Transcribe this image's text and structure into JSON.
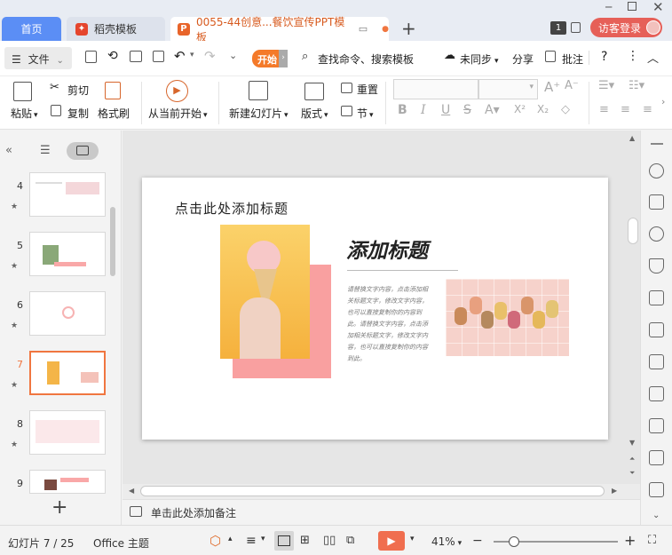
{
  "tabs": {
    "home": "首页",
    "docer": "稻壳模板",
    "doc": "0055-44创意...餐饮宣传PPT模板"
  },
  "account": {
    "badge": "1",
    "login": "访客登录"
  },
  "menu": {
    "file": "文件",
    "start": "开始",
    "search": "查找命令、搜索模板",
    "sync": "未同步",
    "share": "分享",
    "annotate": "批注"
  },
  "ribbon": {
    "paste": "粘贴",
    "cut": "剪切",
    "copy": "复制",
    "format_painter": "格式刷",
    "from_current": "从当前开始",
    "new_slide": "新建幻灯片",
    "layout": "版式",
    "reset": "重置",
    "section": "节"
  },
  "thumbnails": [
    {
      "num": "4",
      "selected": false
    },
    {
      "num": "5",
      "selected": false
    },
    {
      "num": "6",
      "selected": false
    },
    {
      "num": "7",
      "selected": true
    },
    {
      "num": "8",
      "selected": false
    },
    {
      "num": "9",
      "selected": false
    }
  ],
  "slide": {
    "placeholder_title": "点击此处添加标题",
    "heading": "添加标题",
    "body": "请替换文字内容，点击添加相关标题文字，修改文字内容，也可以直接复制你的内容到此。请替换文字内容，点击添加相关标题文字，修改文字内容，也可以直接复制你的内容到此。"
  },
  "notes": {
    "placeholder": "单击此处添加备注"
  },
  "status": {
    "slide_info": "幻灯片 7 / 25",
    "theme": "Office 主题",
    "zoom": "41%"
  },
  "colors": {
    "accent": "#f07640",
    "tab_home": "#5b8ef5",
    "login": "#e66058",
    "pink": "#f9a0a0"
  }
}
